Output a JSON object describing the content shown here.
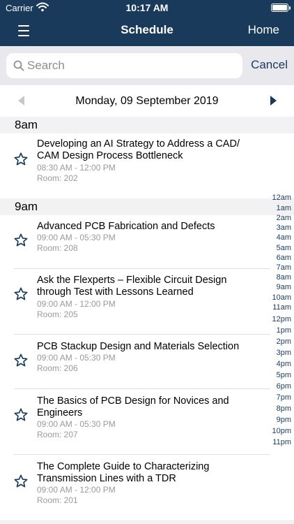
{
  "status_bar": {
    "carrier": "Carrier",
    "time": "10:17 AM"
  },
  "nav": {
    "title": "Schedule",
    "home_label": "Home"
  },
  "search": {
    "placeholder": "Search",
    "value": "",
    "cancel_label": "Cancel"
  },
  "date_bar": {
    "date": "Monday, 09 September 2019"
  },
  "sections": [
    {
      "label": "8am",
      "sessions": [
        {
          "title": "Developing an AI Strategy to Address a CAD/ CAM Design Process Bottleneck",
          "time": "08:30 AM - 12:00 PM",
          "room": "Room: 202"
        }
      ]
    },
    {
      "label": "9am",
      "sessions": [
        {
          "title": "Advanced PCB Fabrication and Defects",
          "time": "09:00 AM - 05:30 PM",
          "room": "Room: 208"
        },
        {
          "title": "Ask the Flexperts – Flexible Circuit Design through Test with Lessons Learned",
          "time": "09:00 AM - 12:00 PM",
          "room": "Room: 205"
        },
        {
          "title": "PCB Stackup Design and Materials Selection",
          "time": "09:00 AM - 05:30 PM",
          "room": "Room: 206"
        },
        {
          "title": "The Basics of PCB Design for Novices and Engineers",
          "time": "09:00 AM - 05:30 PM",
          "room": "Room: 207"
        },
        {
          "title": "The Complete Guide to Characterizing Transmission Lines with a TDR",
          "time": "09:00 AM - 12:00 PM",
          "room": "Room: 201"
        }
      ]
    }
  ],
  "index_bar": [
    "12am",
    "1am",
    "2am",
    "3am",
    "4am",
    "5am",
    "6am",
    "7am",
    "8am",
    "9am",
    "10am",
    "11am",
    "12pm",
    "1pm",
    "2pm",
    "3pm",
    "4pm",
    "5pm",
    "6pm",
    "7pm",
    "8pm",
    "9pm",
    "10pm",
    "11pm"
  ],
  "colors": {
    "nav_bg": "#1a3a5c",
    "accent": "#1a3a5c",
    "muted_text": "#9a9a9e"
  },
  "icons": {
    "menu": "hamburger-icon",
    "search": "search-icon",
    "favorite": "star-outline-icon",
    "wifi": "wifi-icon",
    "battery": "battery-icon"
  }
}
